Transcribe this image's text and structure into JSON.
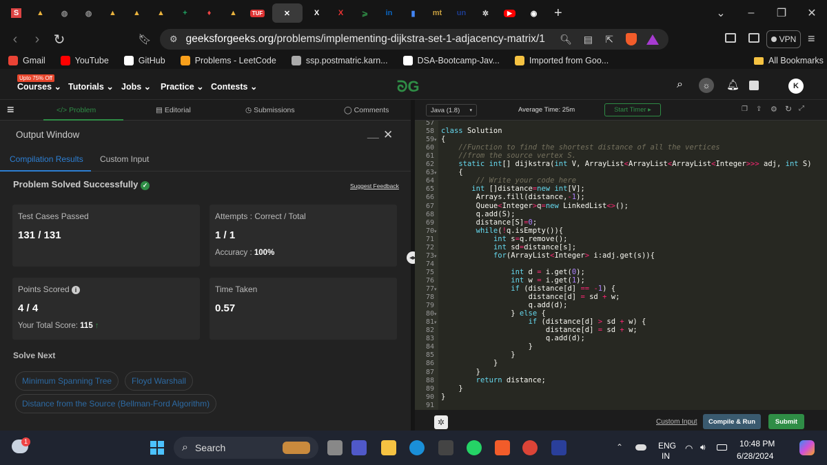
{
  "browser": {
    "url_host": "geeksforgeeks.org",
    "url_path": "/problems/implementing-dijkstra-set-1-adjacency-matrix/1",
    "vpn_label": "VPN",
    "tabs": [
      {
        "icon": "s-icon",
        "color": "#d44"
      },
      {
        "icon": "drive-icon",
        "color": "#e9b23d"
      },
      {
        "icon": "globe-icon",
        "color": "#888"
      },
      {
        "icon": "globe-icon",
        "color": "#888"
      },
      {
        "icon": "drive-icon",
        "color": "#e9b23d"
      },
      {
        "icon": "drive-icon",
        "color": "#e9b23d"
      },
      {
        "icon": "drive-icon",
        "color": "#e9b23d"
      },
      {
        "icon": "sheets-icon",
        "color": "#1fa463"
      },
      {
        "icon": "bell-icon",
        "color": "#e44"
      },
      {
        "icon": "drive-icon",
        "color": "#e9b23d"
      },
      {
        "icon": "tuf-icon",
        "color": "#d33"
      },
      {
        "icon": "close-icon",
        "color": "#fff"
      },
      {
        "icon": "x-icon",
        "color": "#fff"
      },
      {
        "icon": "x-icon",
        "color": "#e33"
      },
      {
        "icon": "gfg-icon",
        "color": "#2f8d46"
      },
      {
        "icon": "linkedin-icon",
        "color": "#0a66c2"
      },
      {
        "icon": "chart-icon",
        "color": "#4285f4"
      },
      {
        "icon": "mt-icon",
        "color": "#c8a040"
      },
      {
        "icon": "un-icon",
        "color": "#1d3c8f"
      },
      {
        "icon": "chatgpt-icon",
        "color": "#ddd"
      },
      {
        "icon": "youtube-icon",
        "color": "#f00"
      },
      {
        "icon": "github-icon",
        "color": "#fff"
      }
    ],
    "tab_labels": {
      "s": "S",
      "tuf": "TUF",
      "x": "X",
      "gfg": "⩾",
      "in": "in",
      "mt": "mt",
      "un": "un"
    }
  },
  "bookmarks": [
    {
      "label": "Gmail",
      "color": "#ea4335"
    },
    {
      "label": "YouTube",
      "color": "#ff0000"
    },
    {
      "label": "GitHub",
      "color": "#ffffff"
    },
    {
      "label": "Problems - LeetCode",
      "color": "#f89f1b"
    },
    {
      "label": "ssp.postmatric.karn...",
      "color": "#aaaaaa"
    },
    {
      "label": "DSA-Bootcamp-Jav...",
      "color": "#ffffff"
    },
    {
      "label": "Imported from Goo...",
      "color": "#f5c242"
    }
  ],
  "bookmarks_all": "All Bookmarks",
  "gfg_header": {
    "promo": "Upto 75% Off",
    "nav": [
      "Courses",
      "Tutorials",
      "Jobs",
      "Practice",
      "Contests"
    ],
    "avatar": "K"
  },
  "problem_tabs": [
    "Problem",
    "Editorial",
    "Submissions",
    "Comments"
  ],
  "output": {
    "title": "Output Window",
    "subtabs": [
      "Compilation Results",
      "Custom Input"
    ],
    "status": "Problem Solved Successfully",
    "feedback": "Suggest Feedback",
    "tests_label": "Test Cases Passed",
    "tests_value": "131 / 131",
    "attempts_label": "Attempts : Correct / Total",
    "attempts_value": "1 / 1",
    "accuracy_label": "Accuracy :",
    "accuracy_value": "100%",
    "points_label": "Points Scored",
    "points_value": "4 / 4",
    "total_label": "Your Total Score:",
    "total_value": "115",
    "time_label": "Time Taken",
    "time_value": "0.57",
    "solve_next": "Solve Next",
    "next_items": [
      "Minimum Spanning Tree",
      "Floyd Warshall",
      "Distance from the Source (Bellman-Ford Algorithm)"
    ]
  },
  "editor": {
    "language": "Java (1.8)",
    "avg_time": "Average Time: 25m",
    "timer": "Start Timer",
    "first_line": 57,
    "fold_lines": [
      59,
      63,
      70,
      73,
      77,
      80,
      81
    ],
    "lines": [
      "",
      "class Solution",
      "{",
      "    //Function to find the shortest distance of all the vertices",
      "    //from the source vertex S.",
      "    static int[] dijkstra(int V, ArrayList<ArrayList<ArrayList<Integer>>> adj, int S)",
      "    {",
      "        // Write your code here",
      "       int []distance=new int[V];",
      "        Arrays.fill(distance,-1);",
      "        Queue<Integer>q=new LinkedList<>();",
      "        q.add(S);",
      "        distance[S]=0;",
      "        while(!q.isEmpty()){",
      "            int s=q.remove();",
      "            int sd=distance[s];",
      "            for(ArrayList<Integer> i:adj.get(s)){",
      "",
      "                int d = i.get(0);",
      "                int w = i.get(1);",
      "                if (distance[d] == -1) {",
      "                    distance[d] = sd + w;",
      "                    q.add(d);",
      "                } else {",
      "                    if (distance[d] > sd + w) {",
      "                        distance[d] = sd + w;",
      "                        q.add(d);",
      "                    }",
      "                }",
      "            }",
      "        }",
      "        return distance;",
      "    }",
      "}",
      ""
    ],
    "custom_input": "Custom Input",
    "compile": "Compile & Run",
    "submit": "Submit"
  },
  "taskbar": {
    "search": "Search",
    "lang1": "ENG",
    "lang2": "IN",
    "time": "10:48 PM",
    "date": "6/28/2024",
    "badge": "1"
  }
}
